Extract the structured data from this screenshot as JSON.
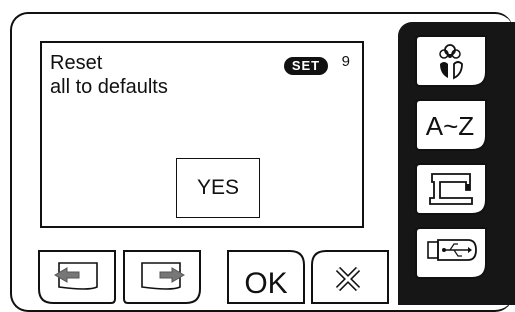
{
  "dialog": {
    "line1": "Reset",
    "line2": "all to defaults",
    "set_badge": "SET",
    "set_number": "9",
    "yes_label": "YES"
  },
  "sidebar": {
    "items": [
      {
        "icon": "flower-leaf-icon"
      },
      {
        "label": "A~Z"
      },
      {
        "icon": "sewing-machine-icon"
      },
      {
        "icon": "usb-stick-icon"
      }
    ]
  },
  "bottom_bar": {
    "prev_icon": "arrow-left-icon",
    "next_icon": "arrow-right-icon",
    "ok_label": "OK",
    "close_icon": "close-x-icon"
  }
}
